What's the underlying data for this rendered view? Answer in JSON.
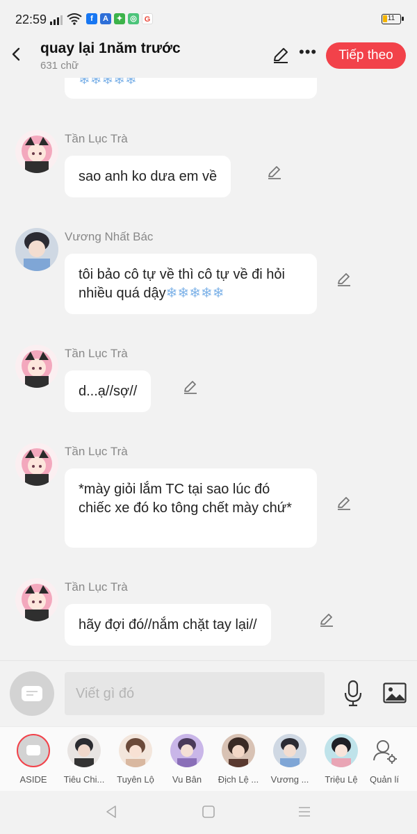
{
  "status": {
    "time": "22:59",
    "battery": "11"
  },
  "header": {
    "title": "quay lại 1năm trước",
    "word_count": "631 chữ",
    "next_label": "Tiếp theo"
  },
  "messages": [
    {
      "sender": "",
      "text": "❄❄❄❄❄",
      "partial": true
    },
    {
      "sender": "Tần Lục Trà",
      "text": "sao anh ko dưa em về"
    },
    {
      "sender": "Vương Nhất Bác",
      "text": "tôi bảo cô tự về thì cô tự về đi hỏi nhiều quá dậy",
      "snow": "❄❄❄❄❄"
    },
    {
      "sender": "Tần Lục Trà",
      "text": "d...ạ//sợ//"
    },
    {
      "sender": "Tần Lục Trà",
      "text": "*mày giỏi lắm TC tại sao lúc đó chiếc xe đó ko tông chết mày chứ*"
    },
    {
      "sender": "Tần Lục Trà",
      "text": "hãy đợi đó//nắm chặt tay lại//"
    }
  ],
  "composer": {
    "placeholder": "Viết gì đó"
  },
  "characters": [
    {
      "name": "ASIDE"
    },
    {
      "name": "Tiêu Chi..."
    },
    {
      "name": "Tuyên Lộ"
    },
    {
      "name": "Vu Bân"
    },
    {
      "name": "Địch Lệ ..."
    },
    {
      "name": "Vương ..."
    },
    {
      "name": "Triệu Lệ"
    },
    {
      "name": "Quản lí"
    }
  ],
  "colors": {
    "accent": "#f2424a",
    "bubble": "#ffffff",
    "background": "#f2f2f2"
  }
}
